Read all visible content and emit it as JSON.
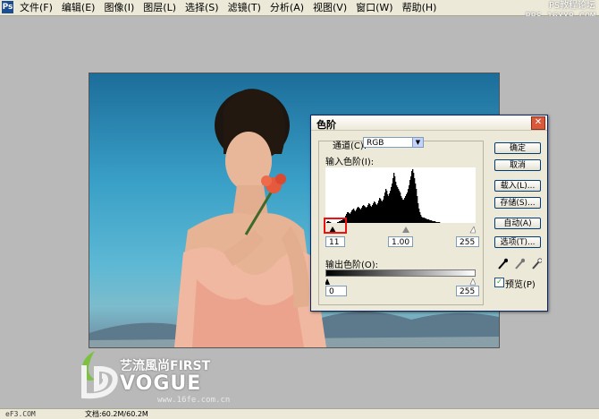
{
  "menubar": {
    "logo": "Ps",
    "items": [
      "文件(F)",
      "编辑(E)",
      "图像(I)",
      "图层(L)",
      "选择(S)",
      "滤镜(T)",
      "分析(A)",
      "视图(V)",
      "窗口(W)",
      "帮助(H)"
    ]
  },
  "watermark": {
    "line1": "PS教程论坛",
    "line2": "BBS.16XX8.COM"
  },
  "logo": {
    "cn": "艺流風尚FIRST",
    "en": "VOGUE",
    "url": "www.16fe.com.cn"
  },
  "statusbar": {
    "left": "eF3.COM",
    "doc": "文档:60.2M/60.2M"
  },
  "dialog": {
    "title": "色阶",
    "close_glyph": "✕",
    "channel_label": "通道(C):",
    "channel_value": "RGB",
    "input_levels_label": "输入色阶(I):",
    "input_black": "11",
    "input_gamma": "1.00",
    "input_white": "255",
    "output_levels_label": "输出色阶(O):",
    "output_black": "0",
    "output_white": "255",
    "buttons": {
      "ok": "确定",
      "cancel": "取消",
      "load": "载入(L)...",
      "save": "存储(S)...",
      "auto": "自动(A)",
      "options": "选项(T)..."
    },
    "preview_label": "预览(P)",
    "preview_checked": true,
    "histogram": [
      0,
      1,
      2,
      2,
      1,
      1,
      0,
      0,
      0,
      0,
      0,
      0,
      0,
      1,
      1,
      2,
      2,
      3,
      3,
      4,
      5,
      6,
      8,
      10,
      12,
      12,
      11,
      10,
      12,
      14,
      15,
      16,
      14,
      13,
      15,
      17,
      18,
      17,
      16,
      15,
      17,
      19,
      20,
      19,
      18,
      17,
      18,
      20,
      22,
      21,
      19,
      18,
      20,
      22,
      24,
      23,
      21,
      20,
      22,
      25,
      28,
      27,
      25,
      24,
      26,
      30,
      34,
      38,
      36,
      32,
      30,
      33,
      36,
      40,
      44,
      50,
      56,
      52,
      46,
      42,
      40,
      38,
      36,
      34,
      30,
      28,
      26,
      26,
      28,
      30,
      32,
      34,
      38,
      42,
      48,
      52,
      58,
      60,
      56,
      50,
      44,
      38,
      30,
      22,
      16,
      12,
      9,
      7,
      6,
      6,
      6,
      5,
      5,
      4,
      4,
      4,
      3,
      3,
      3,
      2,
      2,
      2,
      2,
      1,
      1,
      1,
      1,
      1,
      0,
      0,
      0,
      0,
      0,
      0,
      0,
      0,
      0,
      0,
      0,
      0,
      0,
      0,
      0,
      0,
      0,
      0,
      0,
      0,
      0,
      0,
      0,
      0,
      0,
      0,
      0,
      0,
      0,
      0,
      0,
      0,
      0,
      0,
      0,
      0,
      0,
      0,
      0,
      0
    ],
    "eyedropper_icons": [
      "black-eyedropper-icon",
      "gray-eyedropper-icon",
      "white-eyedropper-icon"
    ]
  }
}
